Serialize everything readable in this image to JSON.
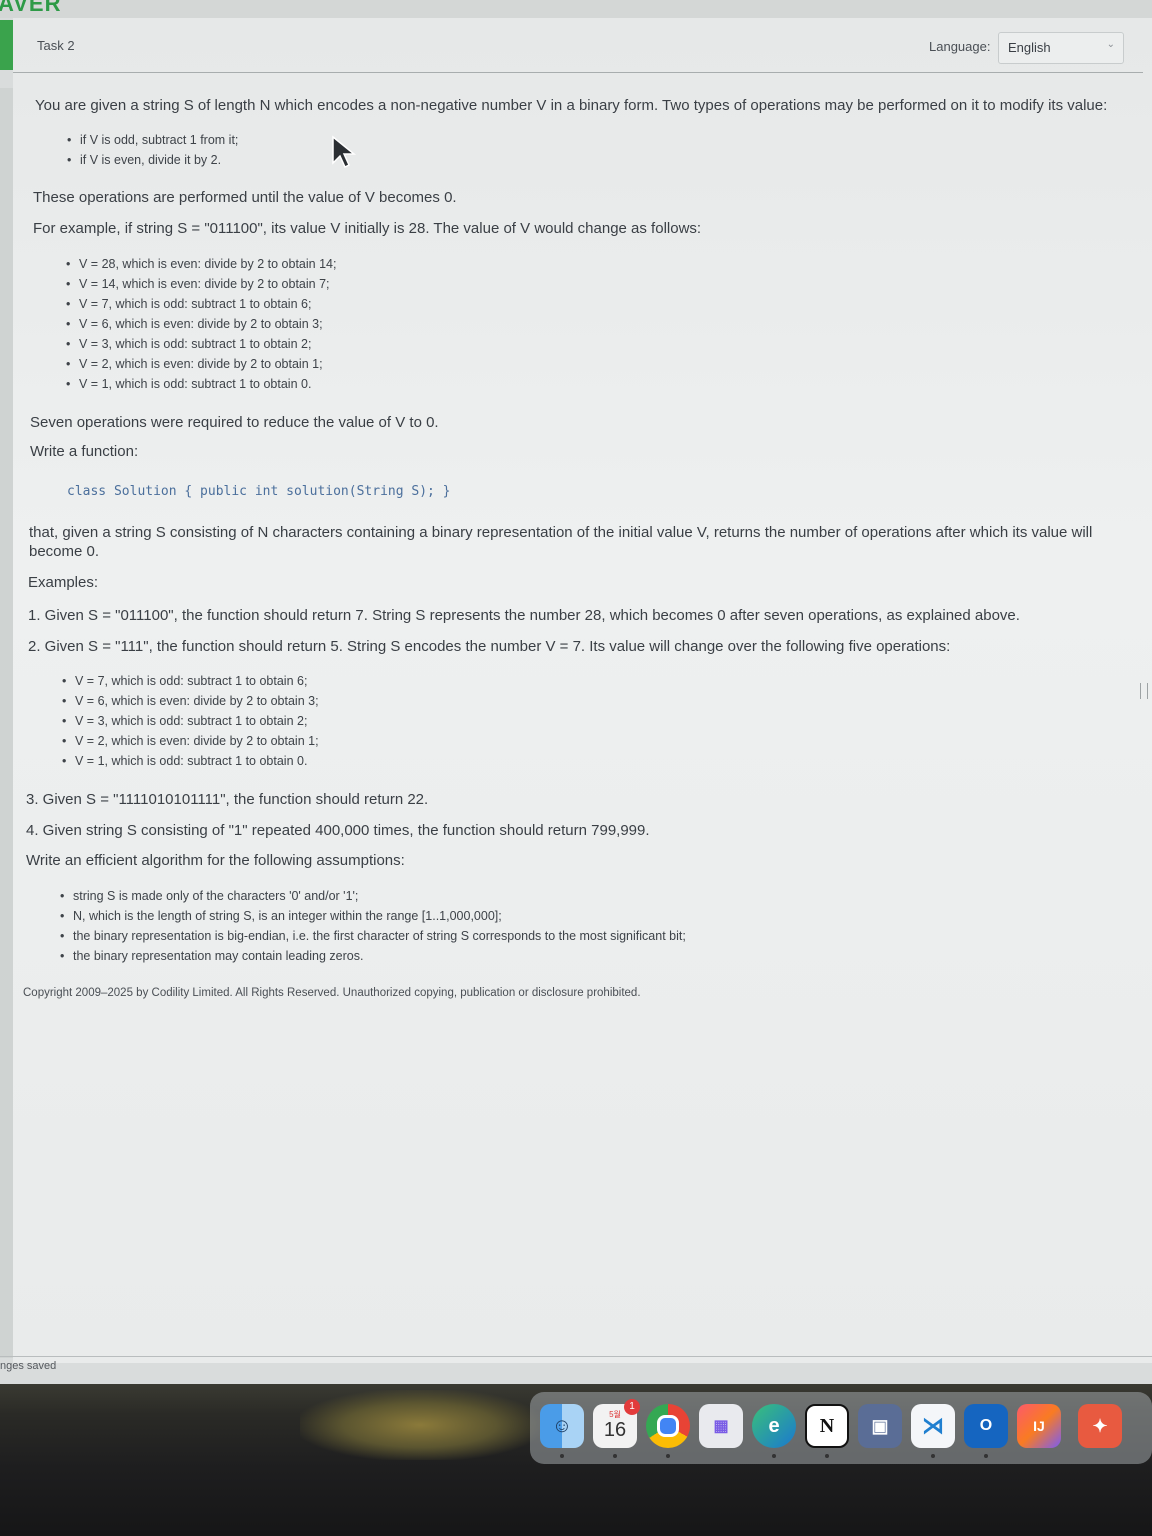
{
  "brand": "AVER",
  "header": {
    "task": "Task 2",
    "language_label": "Language:",
    "language_value": "English"
  },
  "problem": {
    "intro": "You are given a string S of length N which encodes a non-negative number V in a binary form. Two types of operations may be performed on it to modify its value:",
    "ops": [
      "if V is odd, subtract 1 from it;",
      "if V is even, divide it by 2."
    ],
    "until": "These operations are performed until the value of V becomes 0.",
    "example_intro": "For example, if string S = \"011100\", its value V initially is 28. The value of V would change as follows:",
    "steps": [
      "V = 28, which is even: divide by 2 to obtain 14;",
      "V = 14, which is even: divide by 2 to obtain 7;",
      "V = 7, which is odd: subtract 1 to obtain 6;",
      "V = 6, which is even: divide by 2 to obtain 3;",
      "V = 3, which is odd: subtract 1 to obtain 2;",
      "V = 2, which is even: divide by 2 to obtain 1;",
      "V = 1, which is odd: subtract 1 to obtain 0."
    ],
    "seven": "Seven operations were required to reduce the value of V to 0.",
    "write_fn": "Write a function:",
    "signature": "class Solution { public int solution(String S); }",
    "that_line1": "that, given a string S consisting of N characters containing a binary representation of the initial value V, returns the number of operations after which its value will",
    "that_line2": "become 0.",
    "examples_heading": "Examples:",
    "ex1": "1. Given S = \"011100\", the function should return 7. String S represents the number 28, which becomes 0 after seven operations, as explained above.",
    "ex2": "2. Given S = \"111\", the function should return 5. String S encodes the number V = 7. Its value will change over the following five operations:",
    "ex2_steps": [
      "V = 7, which is odd: subtract 1 to obtain 6;",
      "V = 6, which is even: divide by 2 to obtain 3;",
      "V = 3, which is odd: subtract 1 to obtain 2;",
      "V = 2, which is even: divide by 2 to obtain 1;",
      "V = 1, which is odd: subtract 1 to obtain 0."
    ],
    "ex3": "3. Given S = \"1111010101111\", the function should return 22.",
    "ex4": "4. Given string S consisting of \"1\" repeated 400,000 times, the function should return 799,999.",
    "assump_heading": "Write an efficient algorithm for the following assumptions:",
    "assumptions": [
      "string S is made only of the characters '0' and/or '1';",
      "N, which is the length of string S, is an integer within the range [1..1,000,000];",
      "the binary representation is big-endian, i.e. the first character of string S corresponds to the most significant bit;",
      "the binary representation may contain leading zeros."
    ],
    "copyright": "Copyright 2009–2025 by Codility Limited. All Rights Reserved. Unauthorized copying, publication or disclosure prohibited."
  },
  "footer": {
    "saved": "nges saved"
  },
  "dock": {
    "calendar_month": "5월",
    "calendar_day": "16",
    "calendar_badge": "1",
    "apps": [
      "finder-icon",
      "calendar-icon",
      "chrome-icon",
      "launchpad-icon",
      "edge-icon",
      "notion-icon",
      "screen-icon",
      "vscode-icon",
      "outlook-icon",
      "intellij-icon",
      "other-app-icon"
    ]
  }
}
